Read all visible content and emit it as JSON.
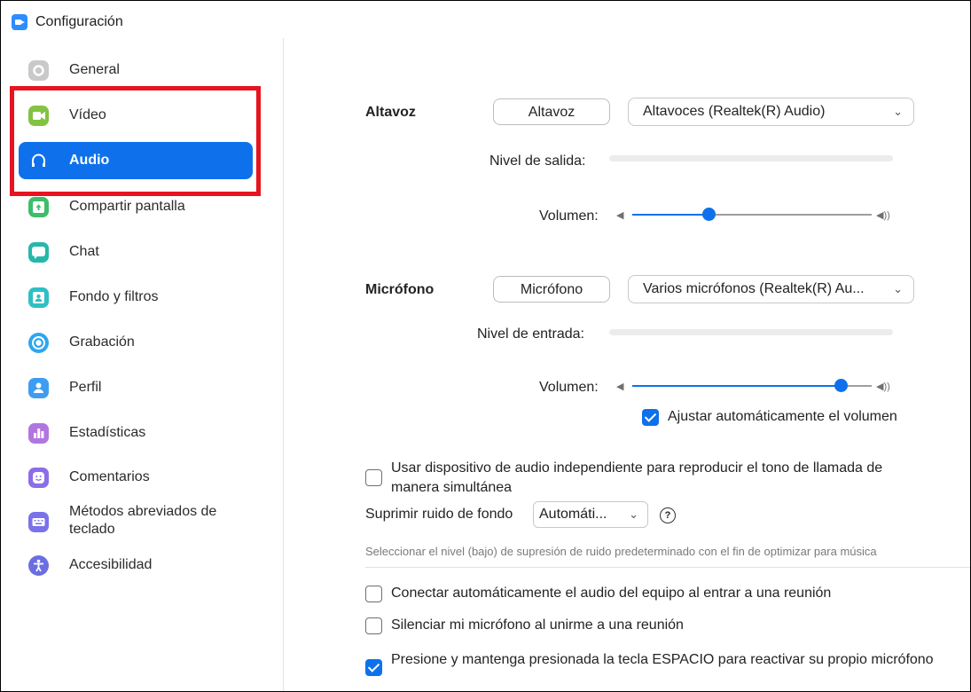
{
  "window": {
    "title": "Configuración"
  },
  "sidebar": {
    "items": [
      {
        "label": "General",
        "icon": "gear-icon",
        "color": "#c8c8c8"
      },
      {
        "label": "Vídeo",
        "icon": "video-icon",
        "color": "#82c341"
      },
      {
        "label": "Audio",
        "icon": "headphones-icon",
        "color": "#ffffff",
        "active": true
      },
      {
        "label": "Compartir pantalla",
        "icon": "share-screen-icon",
        "color": "#3ebd6a"
      },
      {
        "label": "Chat",
        "icon": "chat-icon",
        "color": "#26b7ab"
      },
      {
        "label": "Fondo y filtros",
        "icon": "background-icon",
        "color": "#2ec0c4"
      },
      {
        "label": "Grabación",
        "icon": "record-icon",
        "color": "#2ea6f0"
      },
      {
        "label": "Perfil",
        "icon": "profile-icon",
        "color": "#3d9df3"
      },
      {
        "label": "Estadísticas",
        "icon": "stats-icon",
        "color": "#b275e0"
      },
      {
        "label": "Comentarios",
        "icon": "feedback-icon",
        "color": "#8c6de8"
      },
      {
        "label": "Métodos abreviados de teclado",
        "icon": "keyboard-icon",
        "color": "#7a72e8"
      },
      {
        "label": "Accesibilidad",
        "icon": "accessibility-icon",
        "color": "#6b6ee0"
      }
    ]
  },
  "speaker": {
    "heading": "Altavoz",
    "test_button": "Altavoz",
    "device": "Altavoces (Realtek(R) Audio)",
    "output_level_label": "Nivel de salida:",
    "volume_label": "Volumen:",
    "volume_level": 0.32
  },
  "microphone": {
    "heading": "Micrófono",
    "test_button": "Micrófono",
    "device": "Varios micrófonos (Realtek(R) Au...",
    "input_level_label": "Nivel de entrada:",
    "volume_label": "Volumen:",
    "volume_level": 0.87,
    "auto_adjust_label": "Ajustar automáticamente el volumen",
    "auto_adjust_checked": true
  },
  "options": {
    "separate_device_label_1": "Usar dispositivo de audio independiente para reproducir el tono de llamada de",
    "separate_device_label_2": "manera simultánea",
    "separate_device_checked": false,
    "suppress_noise_label": "Suprimir ruido de fondo",
    "suppress_noise_value": "Automáti...",
    "help_symbol": "?",
    "suppress_hint": "Seleccionar el nivel (bajo) de supresión de ruido predeterminado con el fin de optimizar para música",
    "auto_connect_label": "Conectar automáticamente el audio del equipo al entrar a una reunión",
    "auto_connect_checked": false,
    "mute_on_join_label": "Silenciar mi micrófono al unirme a una reunión",
    "mute_on_join_checked": false,
    "space_unmute_label": "Presione y mantenga presionada la tecla ESPACIO para reactivar su propio micrófono",
    "space_unmute_checked": true
  },
  "colors": {
    "accent": "#0e71eb",
    "highlight_box": "#e6141f"
  }
}
